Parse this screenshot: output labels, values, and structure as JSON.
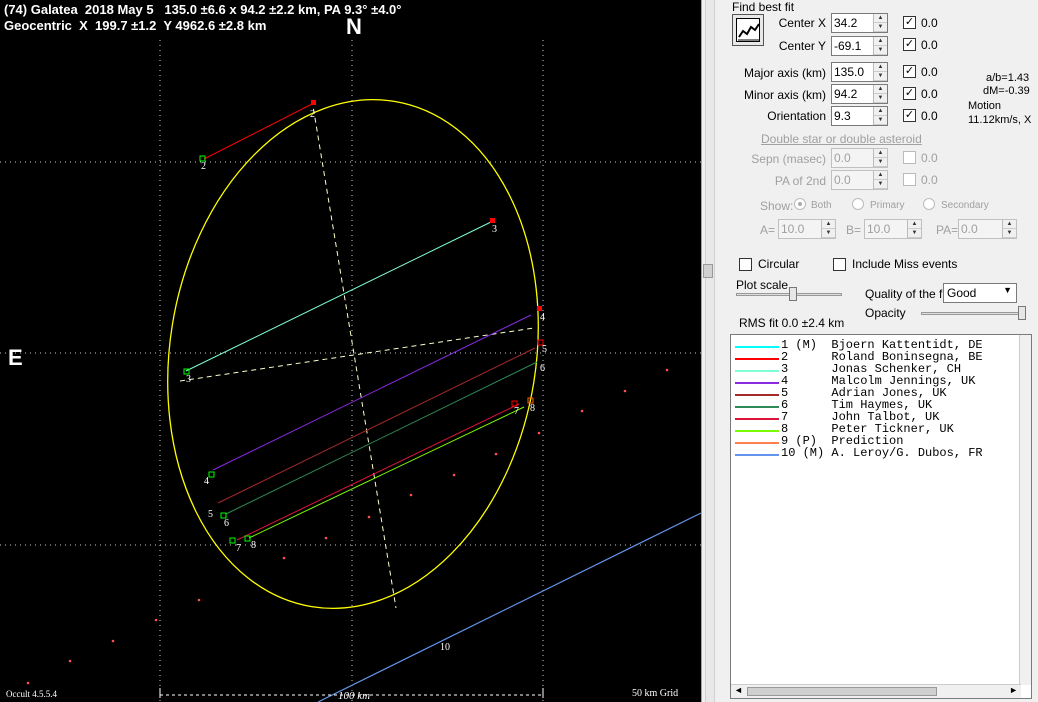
{
  "plot": {
    "title_line1": "(74) Galatea  2018 May 5   135.0 ±6.6 x 94.2 ±2.2 km, PA 9.3° ±4.0°",
    "title_line2": "Geocentric  X  199.7 ±1.2  Y 4962.6 ±2.8 km",
    "north": "N",
    "east": "E",
    "version": "Occult 4.5.5.4",
    "scale_label": "100 km",
    "grid_label": "50 km Grid",
    "colors": {
      "ellipse": "#ffff00",
      "background": "#000000"
    }
  },
  "panel": {
    "find_best_fit": "Find best fit",
    "fit_icon": "chart-fit-icon",
    "center_x_label": "Center X",
    "center_x": "34.2",
    "center_x_delta": "0.0",
    "center_y_label": "Center Y",
    "center_y": "-69.1",
    "center_y_delta": "0.0",
    "major_label": "Major axis (km)",
    "major": "135.0",
    "major_delta": "0.0",
    "minor_label": "Minor axis (km)",
    "minor": "94.2",
    "minor_delta": "0.0",
    "orient_label": "Orientation",
    "orient": "9.3",
    "orient_delta": "0.0",
    "ab": "a/b=1.43",
    "dm": "dM=-0.39",
    "motion_label": "Motion",
    "motion": "11.12km/s, X",
    "double_header": "Double star  or  double asteroid",
    "sepn_label": "Sepn (masec)",
    "sepn": "0.0",
    "sepn_delta": "0.0",
    "pa2_label": "PA of 2nd",
    "pa2": "0.0",
    "pa2_delta": "0.0",
    "show_label": "Show:",
    "show_both": "Both",
    "show_primary": "Primary",
    "show_secondary": "Secondary",
    "a_label": "A=",
    "a_val": "10.0",
    "b_label": "B=",
    "b_val": "10.0",
    "pa_label": "PA=",
    "pa_val": "0.0",
    "circular": "Circular",
    "include_miss": "Include Miss events",
    "plot_scale": "Plot scale",
    "quality_label": "Quality of the fit",
    "quality": "Good",
    "opacity": "Opacity",
    "rms": "RMS fit 0.0 ±2.4 km"
  },
  "observers": [
    {
      "text": "1 (M)  Bjoern Kattentidt, DE",
      "color": "#00ffff"
    },
    {
      "text": "2      Roland Boninsegna, BE",
      "color": "#ff0000"
    },
    {
      "text": "3      Jonas Schenker, CH",
      "color": "#7fffd4"
    },
    {
      "text": "4      Malcolm Jennings, UK",
      "color": "#8a2be2"
    },
    {
      "text": "5      Adrian Jones, UK",
      "color": "#a52a2a"
    },
    {
      "text": "6      Tim Haymes, UK",
      "color": "#2e8b57"
    },
    {
      "text": "7      John Talbot, UK",
      "color": "#dc143c"
    },
    {
      "text": "8      Peter Tickner, UK",
      "color": "#7cfc00"
    },
    {
      "text": "9 (P)  Prediction",
      "color": "#ff7f50"
    },
    {
      "text": "10 (M) A. Leroy/G. Dubos, FR",
      "color": "#6495ed"
    }
  ],
  "chord_labels": [
    "2",
    "3",
    "4",
    "5",
    "6",
    "7",
    "8",
    "1",
    "10"
  ]
}
